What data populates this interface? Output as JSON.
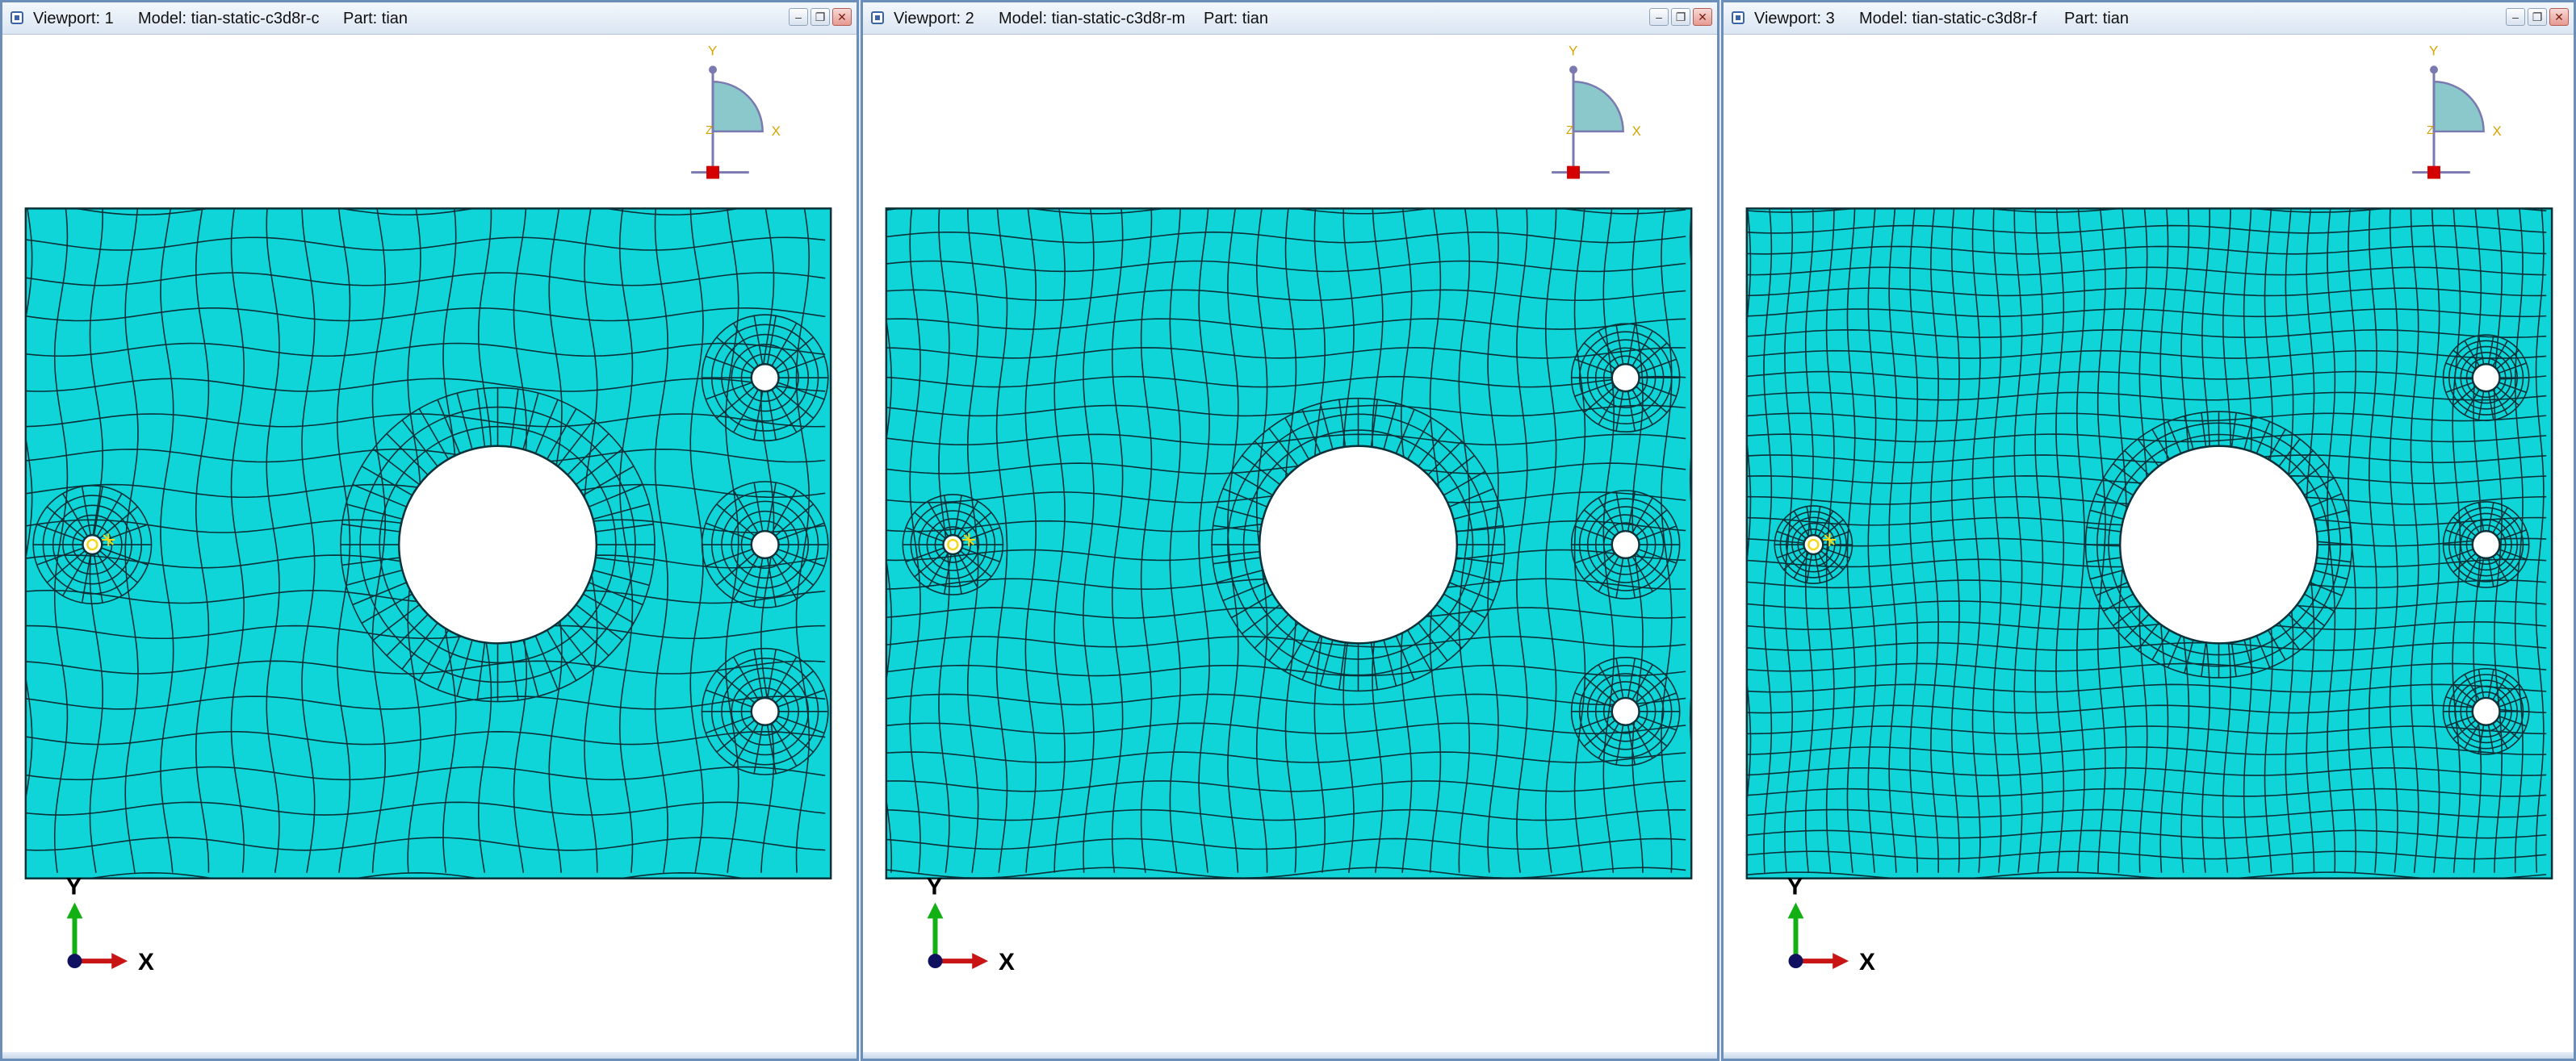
{
  "colors": {
    "mesh_fill": "#0fd5d8",
    "mesh_line": "#0a3038",
    "frame": "#6b8fb8",
    "axis_x": "#c81414",
    "axis_y": "#12b012",
    "origin": "#101060",
    "triad_fill": "#8bc8cc",
    "triad_red": "#d40000"
  },
  "triad": {
    "y_label": "Y",
    "x_label": "X",
    "z_label": "Z"
  },
  "viewports": [
    {
      "viewport_label": "Viewport: 1",
      "model_label": "Model: tian-static-c3d8r-c",
      "part_label": "Part: tian",
      "mesh_density": "coarse"
    },
    {
      "viewport_label": "Viewport: 2",
      "model_label": "Model: tian-static-c3d8r-m",
      "part_label": "Part: tian",
      "mesh_density": "medium"
    },
    {
      "viewport_label": "Viewport: 3",
      "model_label": "Model: tian-static-c3d8r-f",
      "part_label": "Part: tian",
      "mesh_density": "fine"
    }
  ],
  "window_buttons": {
    "minimize": "–",
    "restore": "❐",
    "close": "✕"
  }
}
